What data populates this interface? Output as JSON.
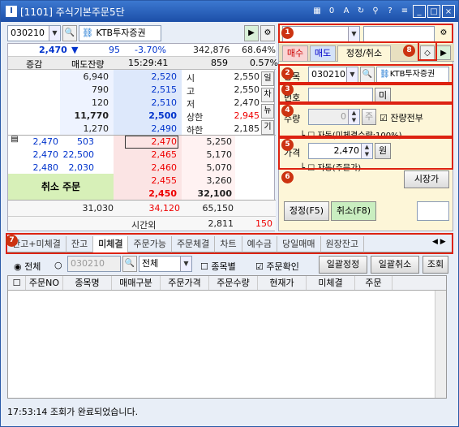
{
  "title": {
    "code": "[1101]",
    "name": "주식기본주문5단"
  },
  "toolbar": {
    "code": "030210",
    "name": "KTB투자증권"
  },
  "quote": {
    "price": "2,470",
    "change": "95",
    "rate": "-3.70%",
    "volume": "342,876",
    "ratio": "68.64%"
  },
  "header": {
    "diff": "증감",
    "ask_qty": "매도잔량",
    "time": "15:29:41",
    "bid_total": "859",
    "bid_ratio": "0.57%"
  },
  "asks": [
    {
      "qty": "6,940",
      "price": "2,520",
      "label": "시",
      "ref": "2,550"
    },
    {
      "qty": "790",
      "price": "2,515",
      "label": "고",
      "ref": "2,550"
    },
    {
      "qty": "120",
      "price": "2,510",
      "label": "저",
      "ref": "2,470"
    },
    {
      "qty": "11,770",
      "price": "2,500",
      "label": "상한",
      "ref": "2,945"
    },
    {
      "qty": "1,270",
      "price": "2,490",
      "label": "하한",
      "ref": "2,185"
    }
  ],
  "side_buttons": [
    "일",
    "차",
    "뉴",
    "기"
  ],
  "bids": [
    {
      "price": "2,470",
      "qty": "5,250"
    },
    {
      "price": "2,465",
      "qty": "5,170"
    },
    {
      "price": "2,460",
      "qty": "5,070"
    },
    {
      "price": "2,455",
      "qty": "3,260"
    },
    {
      "price": "2,450",
      "qty": "32,100"
    }
  ],
  "fills": [
    {
      "price": "2,470",
      "qty": "503"
    },
    {
      "price": "2,470",
      "qty": "22,500"
    },
    {
      "price": "2,480",
      "qty": "2,030"
    }
  ],
  "cancel_order": "취소 주문",
  "totals": {
    "ask_total": "31,030",
    "diff": "34,120",
    "bid_total": "65,150"
  },
  "after_hours": {
    "label": "시간외",
    "qty": "2,811",
    "diff": "150"
  },
  "right": {
    "tabs": [
      "매수",
      "매도",
      "정정/취소"
    ],
    "code_label": "종목",
    "code": "030210",
    "name": "KTB투자증권",
    "order_no_label": "번호",
    "order_no_btn": "미",
    "qty_label": "수량",
    "qty": "0",
    "qty_btn": "주",
    "remain_all": "잔량전부",
    "auto_qty": "자동(미체결수량:100%)",
    "price_label": "가격",
    "price": "2,470",
    "price_unit": "원",
    "auto_price": "자동(주문가)",
    "market_btn": "시장가",
    "modify_btn": "정정(F5)",
    "cancel_btn": "취소(F8)"
  },
  "badges": [
    "1",
    "2",
    "3",
    "4",
    "5",
    "6",
    "7",
    "8"
  ],
  "bottom_tabs": [
    "잔고+미체결",
    "잔고",
    "미체결",
    "주문가능",
    "주문체결",
    "차트",
    "예수금",
    "당일매매",
    "원장잔고"
  ],
  "filter": {
    "all": "전체",
    "code": "030210",
    "type": "전체",
    "by_stock": "종목별",
    "confirm": "주문확인",
    "bulk_modify": "일괄정정",
    "bulk_cancel": "일괄취소",
    "query": "조회"
  },
  "columns": [
    "주문NO",
    "종목명",
    "매매구분",
    "주문가격",
    "주문수량",
    "현재가",
    "미체결",
    "주문"
  ],
  "status": "17:53:14  조회가 완료되었습니다."
}
